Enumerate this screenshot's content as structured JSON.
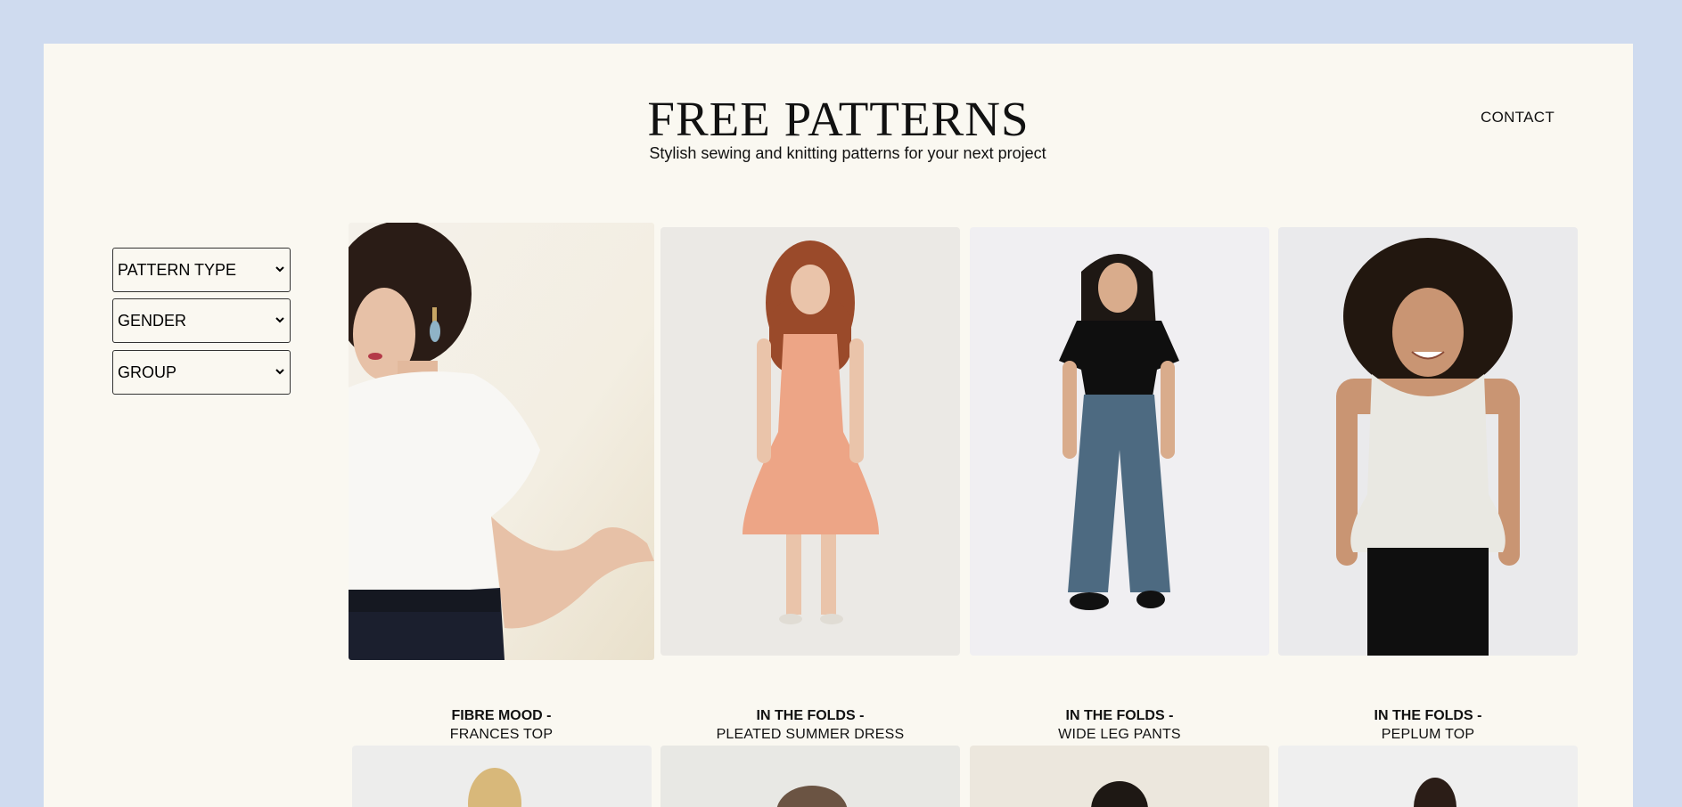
{
  "header": {
    "title": "FREE PATTERNS",
    "subtitle": "Stylish sewing and knitting patterns for your next project",
    "contact": "CONTACT"
  },
  "filters": {
    "pattern_type": "PATTERN TYPE",
    "gender": "GENDER",
    "group": "GROUP"
  },
  "patterns": [
    {
      "brand": "FIBRE MOOD -",
      "name": "FRANCES TOP"
    },
    {
      "brand": "IN THE FOLDS -",
      "name": "PLEATED SUMMER DRESS"
    },
    {
      "brand": "IN THE FOLDS -",
      "name": "WIDE LEG PANTS"
    },
    {
      "brand": "IN THE FOLDS -",
      "name": "PEPLUM TOP"
    }
  ],
  "colors": {
    "page_background": "#cfdbef",
    "panel_background": "#faf8f1",
    "text": "#111111"
  }
}
